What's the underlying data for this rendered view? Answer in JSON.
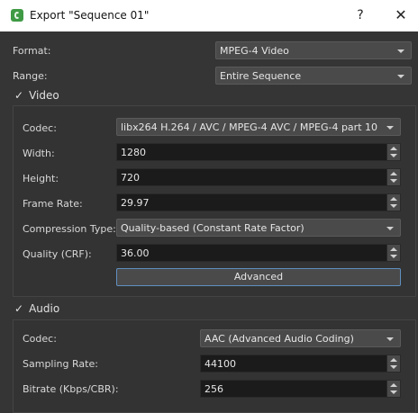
{
  "window": {
    "title": "Export \"Sequence 01\"",
    "help_label": "?",
    "close_label": "✕"
  },
  "format": {
    "label": "Format:",
    "value": "MPEG-4 Video"
  },
  "range": {
    "label": "Range:",
    "value": "Entire Sequence"
  },
  "video": {
    "checkbox_label": "Video",
    "checked": true,
    "codec": {
      "label": "Codec:",
      "value": "libx264 H.264 / AVC / MPEG-4 AVC / MPEG-4 part 10"
    },
    "width": {
      "label": "Width:",
      "value": "1280"
    },
    "height": {
      "label": "Height:",
      "value": "720"
    },
    "frame_rate": {
      "label": "Frame Rate:",
      "value": "29.97"
    },
    "compression_type": {
      "label": "Compression Type:",
      "value": "Quality-based (Constant Rate Factor)"
    },
    "quality": {
      "label": "Quality (CRF):",
      "value": "36.00"
    },
    "advanced_label": "Advanced"
  },
  "audio": {
    "checkbox_label": "Audio",
    "checked": true,
    "codec": {
      "label": "Codec:",
      "value": "AAC (Advanced Audio Coding)"
    },
    "sampling_rate": {
      "label": "Sampling Rate:",
      "value": "44100"
    },
    "bitrate": {
      "label": "Bitrate (Kbps/CBR):",
      "value": "256"
    }
  }
}
